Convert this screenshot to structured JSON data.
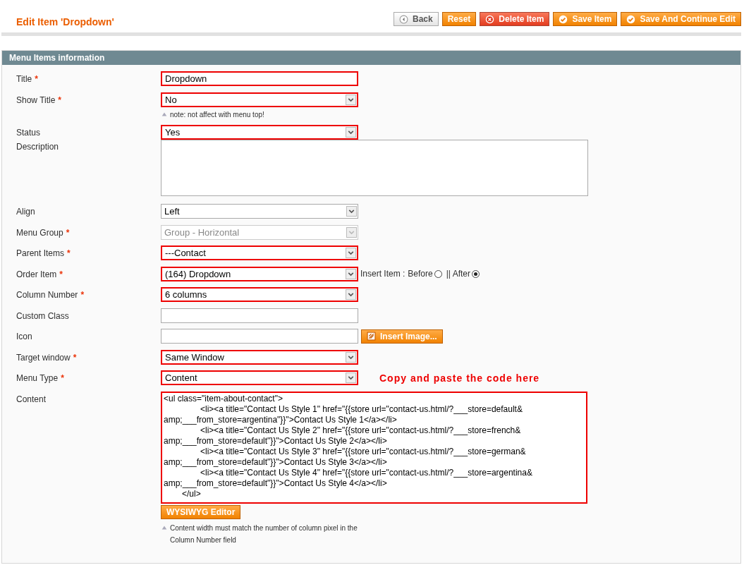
{
  "page_title": "Edit Item 'Dropdown'",
  "buttons": [
    {
      "label": "Back",
      "kind": "back"
    },
    {
      "label": "Reset",
      "kind": "plain"
    },
    {
      "label": "Delete Item",
      "kind": "delete"
    },
    {
      "label": "Save Item",
      "kind": "save"
    },
    {
      "label": "Save And Continue Edit",
      "kind": "save"
    }
  ],
  "section_title": "Menu Items information",
  "fields": [
    {
      "label": "Title",
      "required_mark": "*",
      "kind": "text",
      "value": "Dropdown",
      "highlighted": true
    },
    {
      "label": "Show Title",
      "required_mark": "*",
      "kind": "select",
      "value": "No",
      "highlighted": true,
      "note": "note: not affect with menu top!"
    },
    {
      "label": "Status",
      "kind": "select",
      "value": "Yes",
      "highlighted": true
    },
    {
      "label": "Description",
      "kind": "textarea"
    },
    {
      "label": "Align",
      "kind": "select",
      "value": "Left",
      "highlighted": false
    },
    {
      "label": "Menu Group",
      "required_mark": "*",
      "kind": "select",
      "value": "Group - Horizontal",
      "highlighted": false,
      "disabled": true
    },
    {
      "label": "Parent Items",
      "required_mark": "*",
      "kind": "select",
      "value": "---Contact",
      "highlighted": true
    },
    {
      "label": "Order Item",
      "required_mark": "*",
      "kind": "select",
      "value": "(164) Dropdown",
      "highlighted": true,
      "extra": {
        "kind": "radios",
        "label": "Insert Item :",
        "options": [
          {
            "label": "Before",
            "selected": false
          },
          {
            "label": "|| After",
            "selected": true
          }
        ]
      }
    },
    {
      "label": "Column Number",
      "required_mark": "*",
      "kind": "select",
      "value": "6 columns",
      "highlighted": true
    },
    {
      "label": "Custom Class",
      "kind": "text",
      "highlighted": false
    },
    {
      "label": "Icon",
      "kind": "text",
      "highlighted": false,
      "extra": {
        "kind": "button",
        "label": "Insert Image..."
      }
    },
    {
      "label": "Target window",
      "required_mark": "*",
      "kind": "select",
      "value": "Same Window",
      "highlighted": true
    },
    {
      "label": "Menu Type",
      "required_mark": "*",
      "kind": "select",
      "value": "Content",
      "highlighted": true,
      "extra": {
        "kind": "callout",
        "label": "Copy and paste the code here"
      }
    },
    {
      "label": "Content",
      "kind": "code",
      "highlighted": true,
      "lines": [
        "<ul class=\"item-about-contact\">",
        "\t\t<li><a title=\"Contact Us Style 1\" href=\"{{store url=\"contact-us.html/?___store=default&",
        "amp;___from_store=argentina\"}}\">Contact Us Style 1</a></li>",
        "\t\t<li><a title=\"Contact Us Style 2\" href=\"{{store url=\"contact-us.html/?___store=french&",
        "amp;___from_store=default\"}}\">Contact Us Style 2</a></li>",
        "\t\t<li><a title=\"Contact Us Style 3\" href=\"{{store url=\"contact-us.html/?___store=german&",
        "amp;___from_store=default\"}}\">Contact Us Style 3</a></li>",
        "\t\t<li><a title=\"Contact Us Style 4\" href=\"{{store url=\"contact-us.html/?___store=argentina&",
        "amp;___from_store=default\"}}\">Contact Us Style 4</a></li>",
        "\t</ul>"
      ],
      "button": "WYSIWYG Editor",
      "note": "Content width must match the number of column pixel in the Column Number field"
    }
  ]
}
